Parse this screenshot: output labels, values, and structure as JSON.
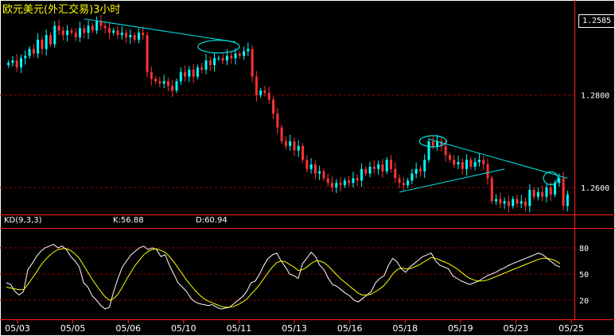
{
  "window": {
    "title": "欧元美元(外汇交易)3小时",
    "last_price": "1.2585"
  },
  "indicator": {
    "name": "KD(9,3,3)",
    "k_text": "K:56.88",
    "d_text": "D:60.94"
  },
  "colors": {
    "background": "#000000",
    "up": "#00ffff",
    "down": "#ff3333",
    "grid": "#990000",
    "trendline": "#00e5e5",
    "k_line": "#ffffff",
    "d_line": "#ffff00"
  },
  "chart_data": [
    {
      "type": "candlestick",
      "title": "欧元美元(外汇交易)3小时",
      "y_tick_labels": [
        "1.2800",
        "1.2600"
      ],
      "y_range": [
        1.2545,
        1.2975
      ],
      "x_tick_labels": [
        "05/03",
        "05/05",
        "05/06",
        "05/10",
        "05/11",
        "05/13",
        "05/16",
        "05/18",
        "05/19",
        "05/23",
        "05/25"
      ],
      "grid": true,
      "approx_closes": [
        1.287,
        1.2875,
        1.286,
        1.288,
        1.2885,
        1.29,
        1.289,
        1.292,
        1.29,
        1.293,
        1.291,
        1.295,
        1.294,
        1.293,
        1.294,
        1.2935,
        1.2925,
        1.2945,
        1.2935,
        1.295,
        1.294,
        1.296,
        1.295,
        1.2945,
        1.2935,
        1.294,
        1.293,
        1.2935,
        1.2925,
        1.293,
        1.292,
        1.2935,
        1.293,
        1.285,
        1.2835,
        1.283,
        1.2825,
        1.283,
        1.282,
        1.281,
        1.283,
        1.285,
        1.284,
        1.2855,
        1.284,
        1.286,
        1.2855,
        1.2875,
        1.2865,
        1.288,
        1.288,
        1.2875,
        1.2885,
        1.288,
        1.289,
        1.2885,
        1.2895,
        1.29,
        1.284,
        1.28,
        1.281,
        1.2805,
        1.279,
        1.276,
        1.273,
        1.27,
        1.269,
        1.27,
        1.268,
        1.269,
        1.266,
        1.264,
        1.265,
        1.263,
        1.2635,
        1.262,
        1.261,
        1.26,
        1.261,
        1.2605,
        1.2615,
        1.261,
        1.262,
        1.2615,
        1.264,
        1.263,
        1.2645,
        1.264,
        1.265,
        1.2635,
        1.266,
        1.264,
        1.262,
        1.261,
        1.2605,
        1.2615,
        1.263,
        1.264,
        1.2635,
        1.266,
        1.27,
        1.269,
        1.27,
        1.269,
        1.267,
        1.266,
        1.265,
        1.2655,
        1.264,
        1.266,
        1.2645,
        1.2655,
        1.266,
        1.265,
        1.262,
        1.257,
        1.2575,
        1.2565,
        1.257,
        1.256,
        1.2575,
        1.2565,
        1.257,
        1.256,
        1.2595,
        1.258,
        1.259,
        1.258,
        1.26,
        1.2585,
        1.261,
        1.262,
        1.256,
        1.2585
      ]
    },
    {
      "type": "line",
      "title": "KD(9,3,3)",
      "y_tick_labels": [
        "80",
        "50",
        "20"
      ],
      "y_range": [
        0,
        100
      ],
      "series": [
        {
          "name": "K:56.88",
          "values": [
            40,
            38,
            30,
            26,
            30,
            55,
            62,
            70,
            76,
            80,
            82,
            84,
            80,
            82,
            78,
            70,
            65,
            58,
            40,
            35,
            25,
            20,
            14,
            10,
            12,
            30,
            45,
            58,
            65,
            72,
            76,
            80,
            82,
            78,
            80,
            78,
            70,
            72,
            60,
            50,
            40,
            35,
            30,
            22,
            18,
            16,
            15,
            14,
            15,
            12,
            10,
            11,
            12,
            16,
            20,
            24,
            30,
            40,
            42,
            50,
            60,
            68,
            72,
            74,
            65,
            58,
            50,
            48,
            45,
            62,
            68,
            75,
            70,
            60,
            55,
            45,
            38,
            36,
            32,
            28,
            25,
            20,
            18,
            22,
            26,
            30,
            40,
            45,
            48,
            60,
            68,
            64,
            56,
            52,
            58,
            62,
            66,
            70,
            72,
            74,
            65,
            60,
            58,
            56,
            48,
            45,
            42,
            40,
            38,
            40,
            42,
            45,
            48,
            50,
            52,
            55,
            57,
            60,
            62,
            64,
            66,
            68,
            70,
            72,
            74,
            72,
            68,
            64,
            60,
            58
          ]
        },
        {
          "name": "D:60.94",
          "values": [
            35,
            34,
            33,
            32,
            32,
            38,
            45,
            52,
            60,
            66,
            71,
            75,
            78,
            79,
            79,
            77,
            73,
            68,
            60,
            52,
            44,
            37,
            30,
            24,
            20,
            22,
            27,
            35,
            44,
            52,
            60,
            66,
            72,
            76,
            78,
            79,
            77,
            75,
            70,
            64,
            57,
            50,
            43,
            37,
            31,
            26,
            22,
            19,
            17,
            15,
            13,
            12,
            12,
            13,
            15,
            18,
            21,
            27,
            32,
            38,
            45,
            52,
            58,
            63,
            65,
            64,
            61,
            58,
            54,
            55,
            58,
            62,
            65,
            65,
            63,
            59,
            54,
            49,
            44,
            40,
            36,
            32,
            28,
            26,
            26,
            27,
            30,
            33,
            37,
            43,
            50,
            55,
            57,
            56,
            56,
            58,
            60,
            63,
            66,
            69,
            68,
            66,
            64,
            62,
            59,
            56,
            52,
            48,
            45,
            43,
            42,
            42,
            43,
            45,
            47,
            49,
            51,
            53,
            55,
            57,
            59,
            61,
            63,
            65,
            67,
            68,
            68,
            67,
            65,
            62
          ]
        }
      ]
    }
  ]
}
